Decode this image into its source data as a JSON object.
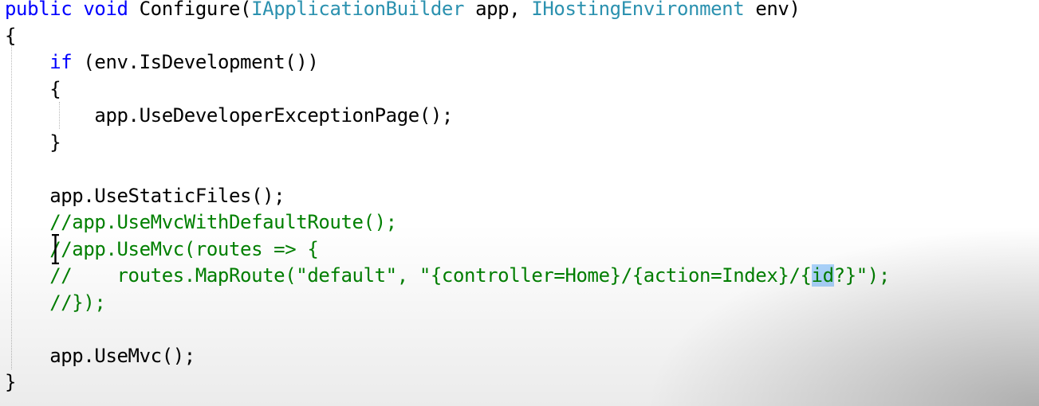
{
  "editor": {
    "lines": [
      {
        "tokens": [
          {
            "t": "public void ",
            "c": "kw"
          },
          {
            "t": "Configure(",
            "c": ""
          },
          {
            "t": "IApplicationBuilder",
            "c": "typ"
          },
          {
            "t": " app, ",
            "c": ""
          },
          {
            "t": "IHostingEnvironment",
            "c": "typ"
          },
          {
            "t": " env)",
            "c": ""
          }
        ]
      },
      {
        "tokens": [
          {
            "t": "{",
            "c": ""
          }
        ]
      },
      {
        "tokens": [
          {
            "t": "    ",
            "c": ""
          },
          {
            "t": "if",
            "c": "kw"
          },
          {
            "t": " (env.IsDevelopment())",
            "c": ""
          }
        ]
      },
      {
        "tokens": [
          {
            "t": "    {",
            "c": ""
          }
        ]
      },
      {
        "tokens": [
          {
            "t": "        app.UseDeveloperExceptionPage();",
            "c": ""
          }
        ]
      },
      {
        "tokens": [
          {
            "t": "    }",
            "c": ""
          }
        ]
      },
      {
        "tokens": [
          {
            "t": "",
            "c": ""
          }
        ]
      },
      {
        "tokens": [
          {
            "t": "    app.UseStaticFiles();",
            "c": ""
          }
        ]
      },
      {
        "tokens": [
          {
            "t": "    //app.UseMvcWithDefaultRoute();",
            "c": "cm"
          }
        ]
      },
      {
        "tokens": [
          {
            "t": "    //app.UseMvc(routes => {",
            "c": "cm"
          }
        ]
      },
      {
        "tokens": [
          {
            "t": "    //    routes.MapRoute(\"default\", \"{controller=Home}/{action=Index}/{",
            "c": "cm"
          },
          {
            "t": "id",
            "c": "cm hl"
          },
          {
            "t": "?}\");",
            "c": "cm"
          }
        ]
      },
      {
        "tokens": [
          {
            "t": "    //});",
            "c": "cm"
          }
        ]
      },
      {
        "tokens": [
          {
            "t": "",
            "c": ""
          }
        ]
      },
      {
        "tokens": [
          {
            "t": "    app.UseMvc();",
            "c": ""
          }
        ]
      },
      {
        "tokens": [
          {
            "t": "}",
            "c": ""
          }
        ]
      }
    ]
  },
  "icons": {
    "caret": "text-cursor-icon"
  },
  "colors": {
    "keyword": "#0000ff",
    "type": "#2b91af",
    "comment": "#008000",
    "highlight": "#add6ff",
    "background": "#ffffff"
  }
}
